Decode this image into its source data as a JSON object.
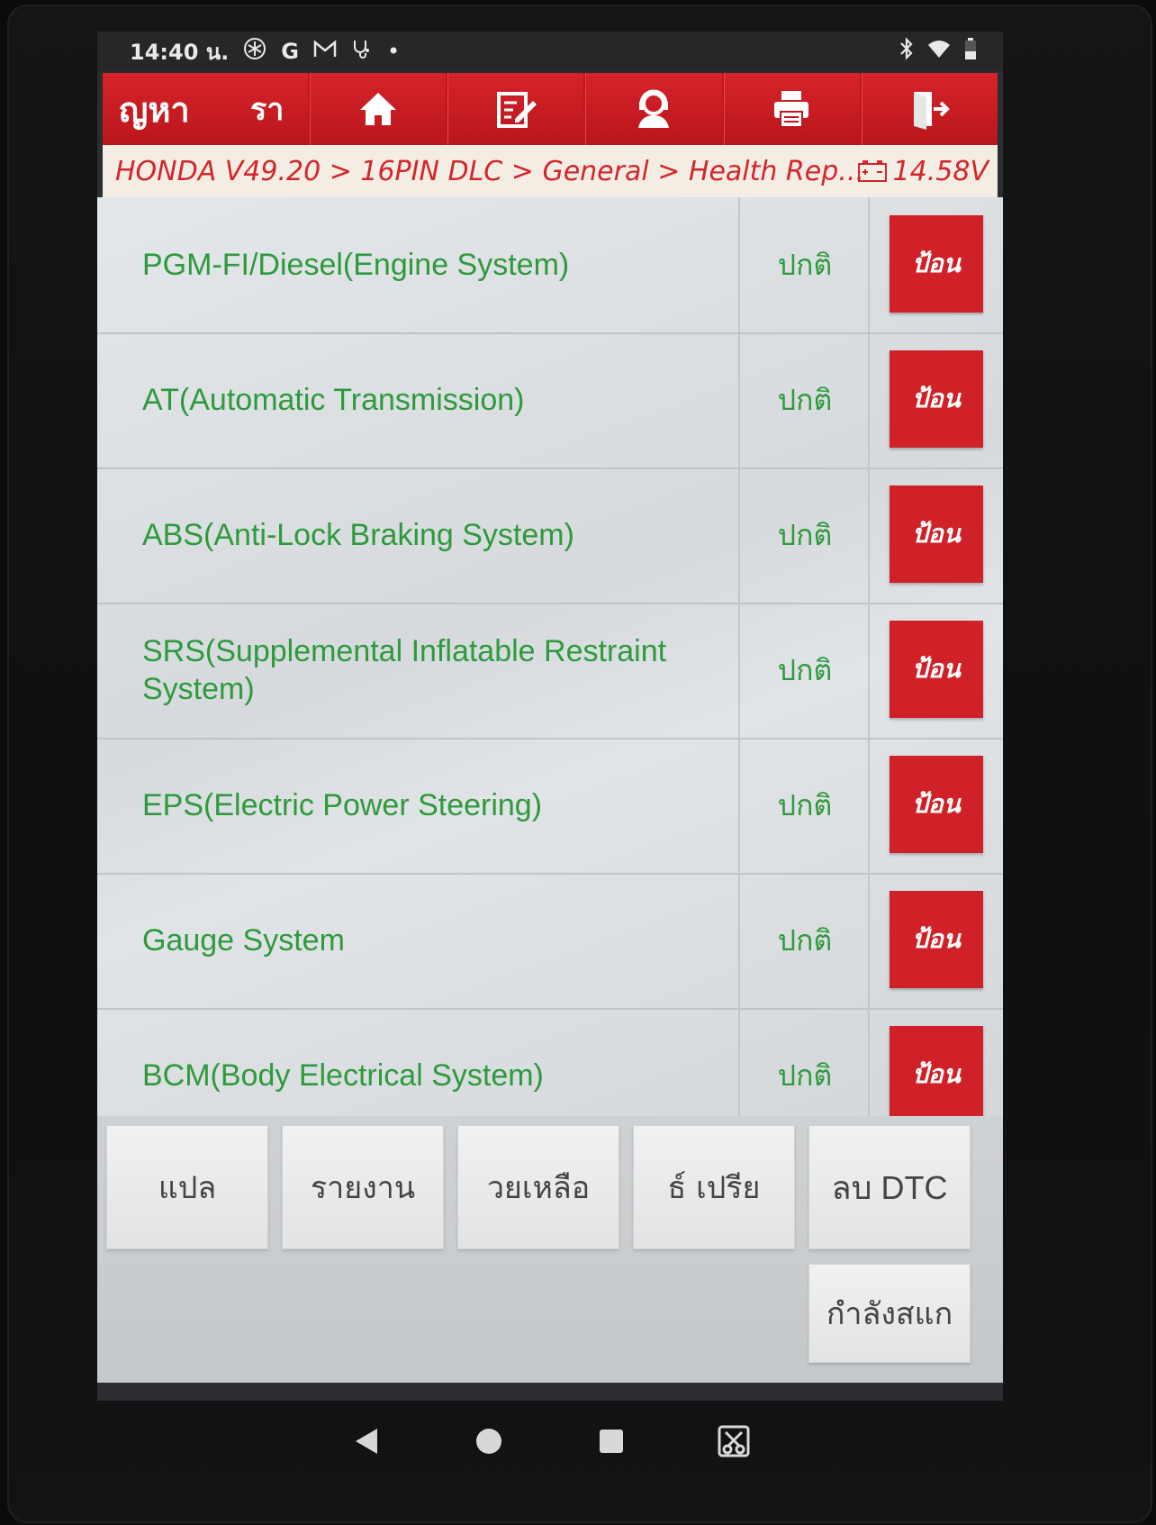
{
  "status_bar": {
    "time": "14:40 น.",
    "icons": [
      "snowflake-icon",
      "google-icon",
      "gmail-icon",
      "stethoscope-icon",
      "dot-icon"
    ],
    "right_icons": [
      "bluetooth-icon",
      "wifi-icon",
      "battery-icon"
    ],
    "google_glyph": "G",
    "dot_glyph": "•"
  },
  "toolbar": {
    "search_label": "ญหา",
    "report_label": "รา",
    "buttons": [
      "home-icon",
      "edit-icon",
      "support-icon",
      "print-icon",
      "exit-icon"
    ]
  },
  "breadcrumb": {
    "path": "HONDA V49.20 > 16PIN DLC > General > Health Rep...",
    "voltage": "14.58V"
  },
  "systems": [
    {
      "name": "PGM-FI/Diesel(Engine System)",
      "status": "ปกติ",
      "action": "ป้อน"
    },
    {
      "name": "AT(Automatic Transmission)",
      "status": "ปกติ",
      "action": "ป้อน"
    },
    {
      "name": "ABS(Anti-Lock Braking System)",
      "status": "ปกติ",
      "action": "ป้อน"
    },
    {
      "name": "SRS(Supplemental Inflatable Restraint System)",
      "status": "ปกติ",
      "action": "ป้อน"
    },
    {
      "name": "EPS(Electric Power Steering)",
      "status": "ปกติ",
      "action": "ป้อน"
    },
    {
      "name": "Gauge System",
      "status": "ปกติ",
      "action": "ป้อน"
    },
    {
      "name": "BCM(Body Electrical System)",
      "status": "ปกติ",
      "action": "ป้อน"
    }
  ],
  "actions": {
    "translate": "แปล",
    "report": "รายงาน",
    "help": "วยเหลือ",
    "compare": "ธ์   เปรีย",
    "clear_dtc": "ลบ DTC",
    "scanning": "กำลังสแก"
  },
  "colors": {
    "accent_red": "#cf2127",
    "ok_green": "#2e9a3c"
  }
}
